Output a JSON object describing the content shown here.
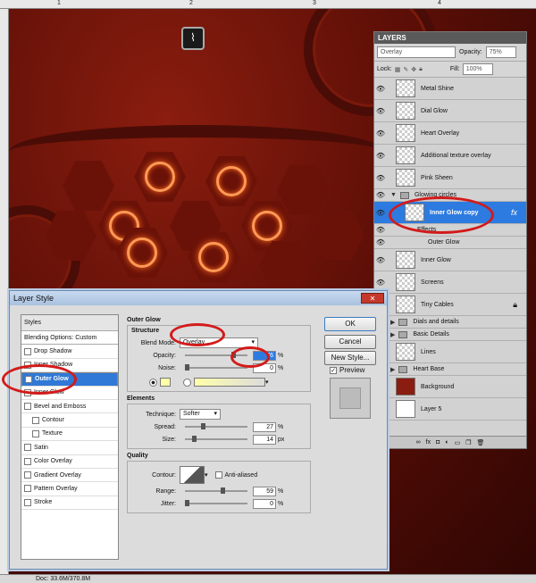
{
  "rulers": {
    "top_numbers": [
      "1",
      "2",
      "3",
      "4"
    ]
  },
  "canvas_badge_icon": "waveform-icon",
  "status_bar": {
    "doc_text": "Doc: 33.6M/370.8M"
  },
  "layers_panel": {
    "title": "LAYERS",
    "blend_mode": "Overlay",
    "opacity_label": "Opacity:",
    "opacity_value": "75%",
    "lock_label": "Lock:",
    "fill_label": "Fill:",
    "fill_value": "100%",
    "layers": [
      {
        "name": "Metal Shine",
        "visible": true,
        "type": "layer"
      },
      {
        "name": "Dial Glow",
        "visible": true,
        "type": "layer"
      },
      {
        "name": "Heart Overlay",
        "visible": true,
        "type": "layer"
      },
      {
        "name": "Additional texture overlay",
        "visible": true,
        "type": "layer"
      },
      {
        "name": "Pink Sheen",
        "visible": true,
        "type": "layer"
      },
      {
        "name": "Glowing circles",
        "visible": true,
        "type": "group"
      },
      {
        "name": "Inner Glow copy",
        "visible": true,
        "type": "layer",
        "selected": true,
        "fx": "fx"
      },
      {
        "name": "Effects",
        "visible": true,
        "type": "effects"
      },
      {
        "name": "Outer Glow",
        "visible": true,
        "type": "effect"
      },
      {
        "name": "Inner Glow",
        "visible": true,
        "type": "layer"
      },
      {
        "name": "Screens",
        "visible": true,
        "type": "layer"
      },
      {
        "name": "Tiny Cables",
        "visible": true,
        "type": "layer",
        "locked": true
      },
      {
        "name": "Dials and details",
        "visible": true,
        "type": "group"
      },
      {
        "name": "Basic Details",
        "visible": true,
        "type": "group"
      },
      {
        "name": "Lines",
        "visible": true,
        "type": "layer"
      },
      {
        "name": "Heart Base",
        "visible": true,
        "type": "group"
      },
      {
        "name": "Background",
        "visible": true,
        "type": "layer"
      },
      {
        "name": "Layer 5",
        "visible": true,
        "type": "layer"
      }
    ],
    "footer_icons": [
      "link-icon",
      "fx-icon",
      "mask-icon",
      "adjustment-icon",
      "folder-icon",
      "new-layer-icon",
      "trash-icon"
    ]
  },
  "dialog": {
    "title": "Layer Style",
    "styles_header": "Styles",
    "blending_options": "Blending Options: Custom",
    "style_items": [
      {
        "label": "Drop Shadow",
        "checked": false,
        "sub": false,
        "selected": false
      },
      {
        "label": "Inner Shadow",
        "checked": false,
        "sub": false,
        "selected": false
      },
      {
        "label": "Outer Glow",
        "checked": true,
        "sub": false,
        "selected": true
      },
      {
        "label": "Inner Glow",
        "checked": false,
        "sub": false,
        "selected": false
      },
      {
        "label": "Bevel and Emboss",
        "checked": false,
        "sub": false,
        "selected": false
      },
      {
        "label": "Contour",
        "checked": false,
        "sub": true,
        "selected": false
      },
      {
        "label": "Texture",
        "checked": false,
        "sub": true,
        "selected": false
      },
      {
        "label": "Satin",
        "checked": false,
        "sub": false,
        "selected": false
      },
      {
        "label": "Color Overlay",
        "checked": false,
        "sub": false,
        "selected": false
      },
      {
        "label": "Gradient Overlay",
        "checked": false,
        "sub": false,
        "selected": false
      },
      {
        "label": "Pattern Overlay",
        "checked": false,
        "sub": false,
        "selected": false
      },
      {
        "label": "Stroke",
        "checked": false,
        "sub": false,
        "selected": false
      }
    ],
    "outer_glow": {
      "heading": "Outer Glow",
      "structure": {
        "heading": "Structure",
        "blend_mode_label": "Blend Mode:",
        "blend_mode_value": "Overlay",
        "opacity_label": "Opacity:",
        "opacity_value": "76",
        "noise_label": "Noise:",
        "noise_value": "0",
        "glow_color": "#ffffaa"
      },
      "elements": {
        "heading": "Elements",
        "technique_label": "Technique:",
        "technique_value": "Softer",
        "spread_label": "Spread:",
        "spread_value": "27",
        "size_label": "Size:",
        "size_value": "14"
      },
      "quality": {
        "heading": "Quality",
        "contour_label": "Contour:",
        "anti_aliased_label": "Anti-aliased",
        "range_label": "Range:",
        "range_value": "59",
        "jitter_label": "Jitter:",
        "jitter_value": "0"
      },
      "unit_percent": "%",
      "unit_px": "px"
    },
    "buttons": {
      "ok": "OK",
      "cancel": "Cancel",
      "new_style": "New Style..."
    },
    "preview_label": "Preview"
  }
}
